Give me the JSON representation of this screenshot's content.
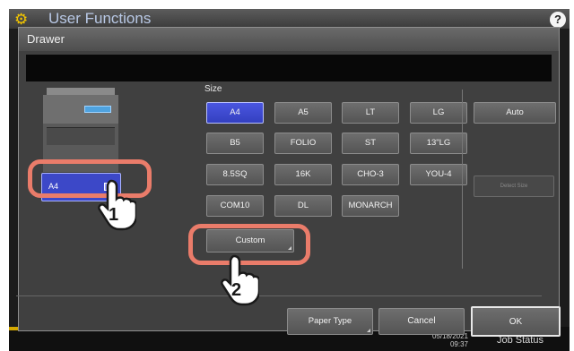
{
  "colors": {
    "screen_bg": "#1c1c1c",
    "dialog_bg": "#404040",
    "selected_blue": "#3c48c8",
    "callout": "#ea7c6a",
    "gear_yellow": "#f2c500"
  },
  "app": {
    "icon": "gear-icon",
    "title": "User Functions",
    "help_icon": "help-icon",
    "help_label": "?"
  },
  "dialog": {
    "title": "Drawer",
    "message": ""
  },
  "drawer_button": {
    "label": "A4",
    "icon": "paper-tray-icon"
  },
  "size": {
    "label": "Size",
    "selected": "A4",
    "buttons": [
      [
        "A4",
        "A5",
        "LT",
        "LG"
      ],
      [
        "B5",
        "FOLIO",
        "ST",
        "13\"LG"
      ],
      [
        "8.5SQ",
        "16K",
        "CHO-3",
        "YOU-4"
      ],
      [
        "COM10",
        "DL",
        "MONARCH"
      ]
    ],
    "custom_label": "Custom"
  },
  "side": {
    "auto_label": "Auto",
    "detect_size_label": "Detect Size"
  },
  "footer": {
    "paper_type_label": "Paper Type",
    "cancel_label": "Cancel",
    "ok_label": "OK"
  },
  "statusbar": {
    "date": "05/18/2021",
    "time": "09:37",
    "job_status_label": "Job Status"
  },
  "callouts": {
    "step1": "1",
    "step2": "2"
  }
}
